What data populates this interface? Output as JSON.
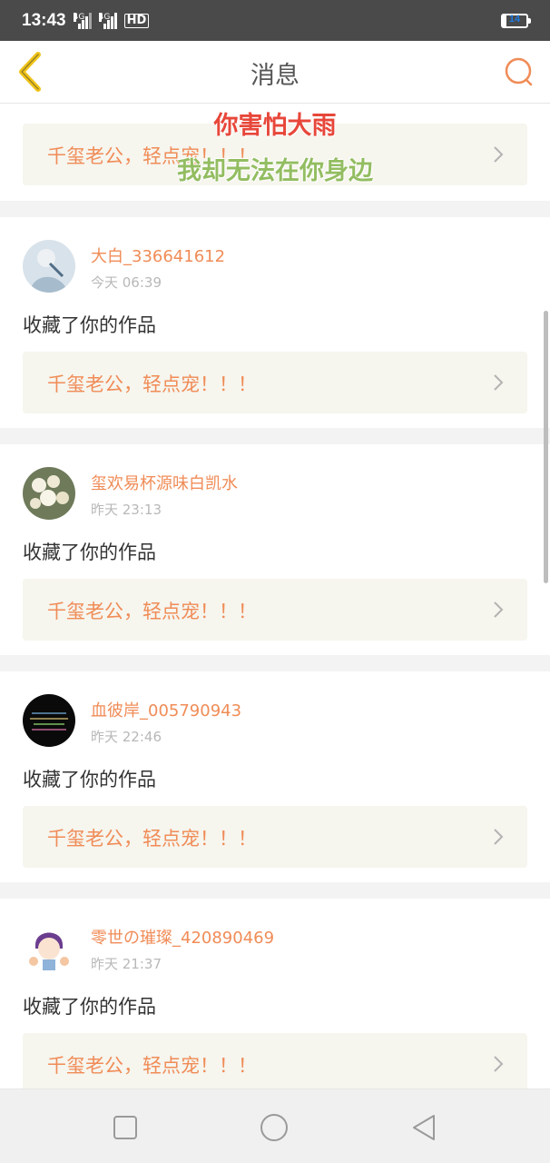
{
  "status_bar": {
    "time": "13:43",
    "signal1_label": "4G",
    "signal2_label": "4G",
    "hd_label": "HD",
    "battery": "14",
    "battery_level": 0.14
  },
  "header": {
    "title": "消息",
    "back_icon": "chevron-left-icon",
    "search_icon": "search-icon"
  },
  "lyrics": {
    "line1": "你害怕大雨",
    "line2": "我却无法在你身边"
  },
  "messages": [
    {
      "work_title": "千玺老公，轻点宠！！！"
    },
    {
      "username": "大白_336641612",
      "time": "今天 06:39",
      "action": "收藏了你的作品",
      "work_title": "千玺老公，轻点宠！！！"
    },
    {
      "username": "玺欢易杯源味白凯水",
      "time": "昨天 23:13",
      "action": "收藏了你的作品",
      "work_title": "千玺老公，轻点宠！！！"
    },
    {
      "username": "血彼岸_005790943",
      "time": "昨天 22:46",
      "action": "收藏了你的作品",
      "work_title": "千玺老公，轻点宠！！！"
    },
    {
      "username": "零世の璀璨_420890469",
      "time": "昨天 21:37",
      "action": "收藏了你的作品",
      "work_title": "千玺老公，轻点宠！！！"
    }
  ],
  "nav": {
    "recent_icon": "square-icon",
    "home_icon": "circle-icon",
    "back_icon": "triangle-back-icon"
  },
  "colors": {
    "accent": "#f08c57",
    "back_arrow": "#f0c419",
    "lyric1": "#e7473a",
    "lyric2": "#93bd61"
  }
}
